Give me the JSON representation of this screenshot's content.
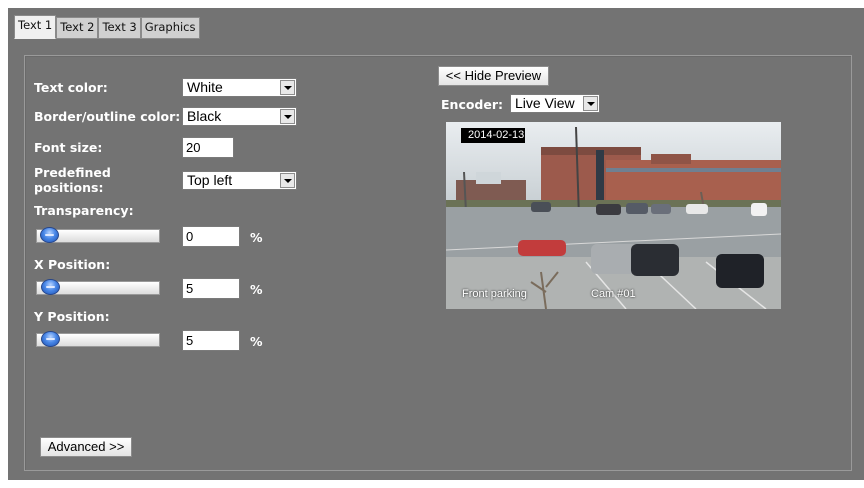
{
  "tabs": [
    {
      "label": "Text 1",
      "active": true
    },
    {
      "label": "Text 2",
      "active": false
    },
    {
      "label": "Text 3",
      "active": false
    },
    {
      "label": "Graphics",
      "active": false
    }
  ],
  "form": {
    "text_color": {
      "label": "Text color:",
      "value": "White"
    },
    "border_color": {
      "label": "Border/outline color:",
      "value": "Black"
    },
    "font_size": {
      "label": "Font size:",
      "value": "20"
    },
    "positions": {
      "label_line1": "Predefined",
      "label_line2": "positions:",
      "value": "Top left"
    },
    "transparency": {
      "label": "Transparency:",
      "value": "0",
      "unit": "%",
      "slider_fraction": 0.0
    },
    "x_position": {
      "label": "X Position:",
      "value": "5",
      "unit": "%",
      "slider_fraction": 0.05
    },
    "y_position": {
      "label": "Y Position:",
      "value": "5",
      "unit": "%",
      "slider_fraction": 0.05
    },
    "advanced_label": "Advanced >>"
  },
  "preview": {
    "hide_label": "<< Hide Preview",
    "encoder_label": "Encoder:",
    "encoder_value": "Live View",
    "date_overlay": "2014-02-13",
    "caption_left": "Front parking",
    "caption_right": "Cam #01"
  },
  "colors": {
    "background": "#737373",
    "text": "#ffffff",
    "slider_knob": "#4a88e8"
  }
}
